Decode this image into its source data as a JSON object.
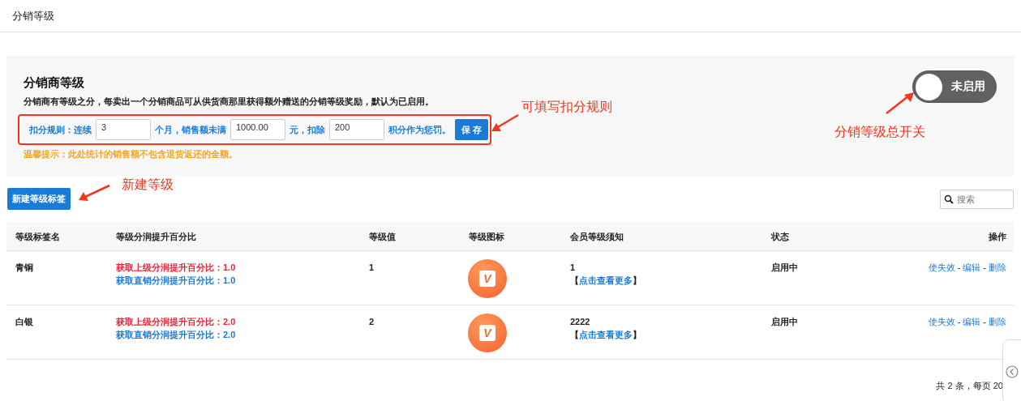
{
  "header": {
    "title": "分销等级"
  },
  "panel": {
    "title": "分销商等级",
    "description": "分销商有等级之分，每卖出一个分销商品可从供货商那里获得额外赠送的分销等级奖励，默认为已启用。",
    "rule": [
      {
        "kind": "text",
        "text": "扣分规则：连续"
      },
      {
        "kind": "input",
        "value": "3"
      },
      {
        "kind": "text",
        "text": "个月，销售额未满"
      },
      {
        "kind": "input",
        "value": "1000.00"
      },
      {
        "kind": "text",
        "text": "元，扣除"
      },
      {
        "kind": "input",
        "value": "200"
      },
      {
        "kind": "text",
        "text": "积分作为惩罚。"
      },
      {
        "kind": "button",
        "text": "保 存"
      }
    ],
    "tip": "温馨提示：此处统计的销售额不包含退货返还的金额。",
    "toggle": {
      "label": "未启用",
      "on": false
    }
  },
  "toolbar": {
    "new_button": "新建等级标签",
    "search": {
      "placeholder": "搜索"
    }
  },
  "table": {
    "columns": [
      "等级标签名",
      "等级分润提升百分比",
      "等级值",
      "等级图标",
      "会员等级须知",
      "状态",
      "操作"
    ],
    "rows": [
      {
        "name": "青铜",
        "upper": "获取上级分润提升百分比：1.0",
        "direct": "获取直销分润提升百分比：1.0",
        "value": "1",
        "icon_letter": "V",
        "notice": "1",
        "more": {
          "open": "【",
          "link": "点击查看更多",
          "close": "】"
        },
        "status": "启用中",
        "actions": [
          {
            "kind": "link",
            "text": "使失效"
          },
          {
            "kind": "separator",
            "text": "-"
          },
          {
            "kind": "link",
            "text": "编辑"
          },
          {
            "kind": "separator",
            "text": "-"
          },
          {
            "kind": "link",
            "text": "删除"
          }
        ]
      },
      {
        "name": "白银",
        "upper": "获取上级分润提升百分比：2.0",
        "direct": "获取直销分润提升百分比：2.0",
        "value": "2",
        "icon_letter": "V",
        "notice": "2222",
        "more": {
          "open": "【",
          "link": "点击查看更多",
          "close": "】"
        },
        "status": "启用中",
        "actions": [
          {
            "kind": "link",
            "text": "使失效"
          },
          {
            "kind": "separator",
            "text": "-"
          },
          {
            "kind": "link",
            "text": "编辑"
          },
          {
            "kind": "separator",
            "text": "-"
          },
          {
            "kind": "link",
            "text": "删除"
          }
        ]
      }
    ]
  },
  "pagination": {
    "summary": "共 2 条，每页 20"
  },
  "annotations": [
    {
      "text": "可填写扣分规则"
    },
    {
      "text": "分销等级总开关"
    },
    {
      "text": "新建等级"
    }
  ]
}
